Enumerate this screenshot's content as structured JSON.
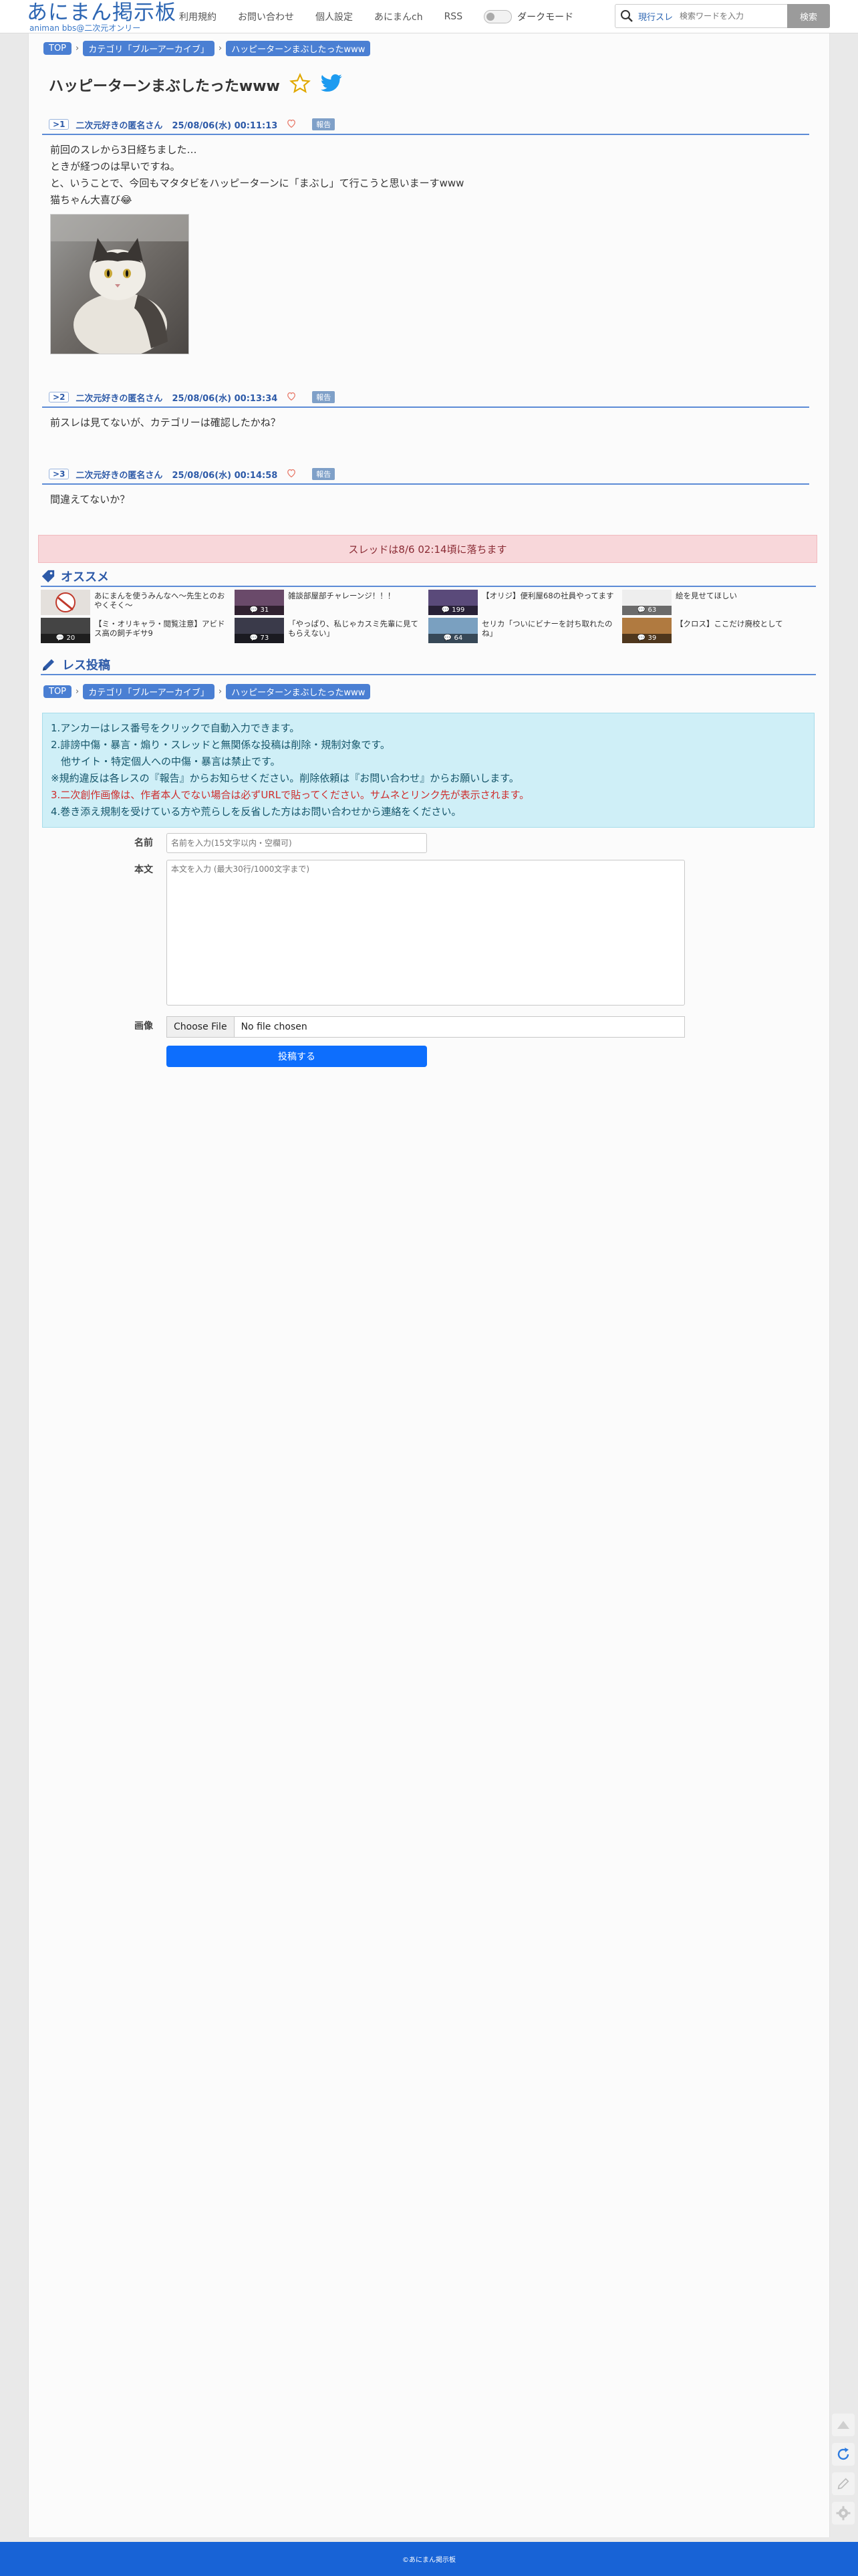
{
  "header": {
    "logo_main": "あにまん掲示板",
    "logo_sub": "animan bbs@二次元オンリー",
    "nav": [
      "利用規約",
      "お問い合わせ",
      "個人設定",
      "あにまんch",
      "RSS"
    ],
    "dark_mode_label": "ダークモード",
    "search_scope": "現行スレ",
    "search_placeholder": "検索ワードを入力",
    "search_button": "検索"
  },
  "breadcrumb": [
    "TOP",
    "カテゴリ「ブルーアーカイブ」",
    "ハッピーターンまぶしたったwww"
  ],
  "thread_title": "ハッピーターンまぶしたったwww",
  "posts": [
    {
      "num": "1",
      "name": "二次元好きの匿名さん",
      "date": "25/08/06(水) 00:11:13",
      "report": "報告",
      "lines": [
        "前回のスレから3日経ちました…",
        "ときが経つのは早いですね。",
        "と、いうことで、今回もマタタビをハッピーターンに「まぶし」て行こうと思いまーすwww",
        "猫ちゃん大喜び😂"
      ]
    },
    {
      "num": "2",
      "name": "二次元好きの匿名さん",
      "date": "25/08/06(水) 00:13:34",
      "report": "報告",
      "lines": [
        "前スレは見てないが、カテゴリーは確認したかね？"
      ]
    },
    {
      "num": "3",
      "name": "二次元好きの匿名さん",
      "date": "25/08/06(水) 00:14:58",
      "report": "報告",
      "lines": [
        "間違えてないか？"
      ]
    }
  ],
  "fall_notice": "スレッドは8/6 02:14頃に落ちます",
  "recommend": {
    "title": "オススメ",
    "items": [
      {
        "text": "あにまんを使うみんなへ〜先生とのおやくそく〜",
        "count": "",
        "color": "#ddd"
      },
      {
        "text": "雑談部屋部チャレーンジ！！！",
        "count": "31",
        "color": "#6a4a6a"
      },
      {
        "text": "【オリジ】便利屋68の社員やってます",
        "count": "199",
        "color": "#5a4a7a"
      },
      {
        "text": "絵を見せてほしい",
        "count": "63",
        "color": "#eee"
      },
      {
        "text": "【ミ・オリキャラ・閲覧注意】アビドス高の飼チギサ9",
        "count": "20",
        "color": "#444"
      },
      {
        "text": "「やっぱり、私じゃカスミ先輩に見てもらえない」",
        "count": "73",
        "color": "#3a3a4a"
      },
      {
        "text": "セリカ「ついにビナーを討ち取れたのね」",
        "count": "64",
        "color": "#7aa0c0"
      },
      {
        "text": "【クロス】ここだけ廃校として",
        "count": "39",
        "color": "#b07a40"
      }
    ]
  },
  "post_form": {
    "title": "レス投稿",
    "rules": [
      "1.アンカーはレス番号をクリックで自動入力できます。",
      "2.誹謗中傷・暴言・煽り・スレッドと無関係な投稿は削除・規制対象です。",
      "　他サイト・特定個人への中傷・暴言は禁止です。",
      "※規約違反は各レスの『報告』からお知らせください。削除依頼は『お問い合わせ』からお願いします。",
      "3.二次創作画像は、作者本人でない場合は必ずURLで貼ってください。サムネとリンク先が表示されます。",
      "4.巻き添え規制を受けている方や荒らしを反省した方はお問い合わせから連絡をください。"
    ],
    "name_label": "名前",
    "name_placeholder": "名前を入力(15文字以内・空欄可)",
    "body_label": "本文",
    "body_placeholder": "本文を入力 (最大30行/1000文字まで)",
    "image_label": "画像",
    "file_button": "Choose File",
    "file_status": "No file chosen",
    "submit": "投稿する"
  },
  "footer": "©あにまん掲示板",
  "colors": {
    "accent": "#2d5aa8",
    "footer": "#1863d6",
    "submit": "#0d6efd",
    "notice_bg": "#f8d7da",
    "rules_bg": "#cfeff7"
  }
}
